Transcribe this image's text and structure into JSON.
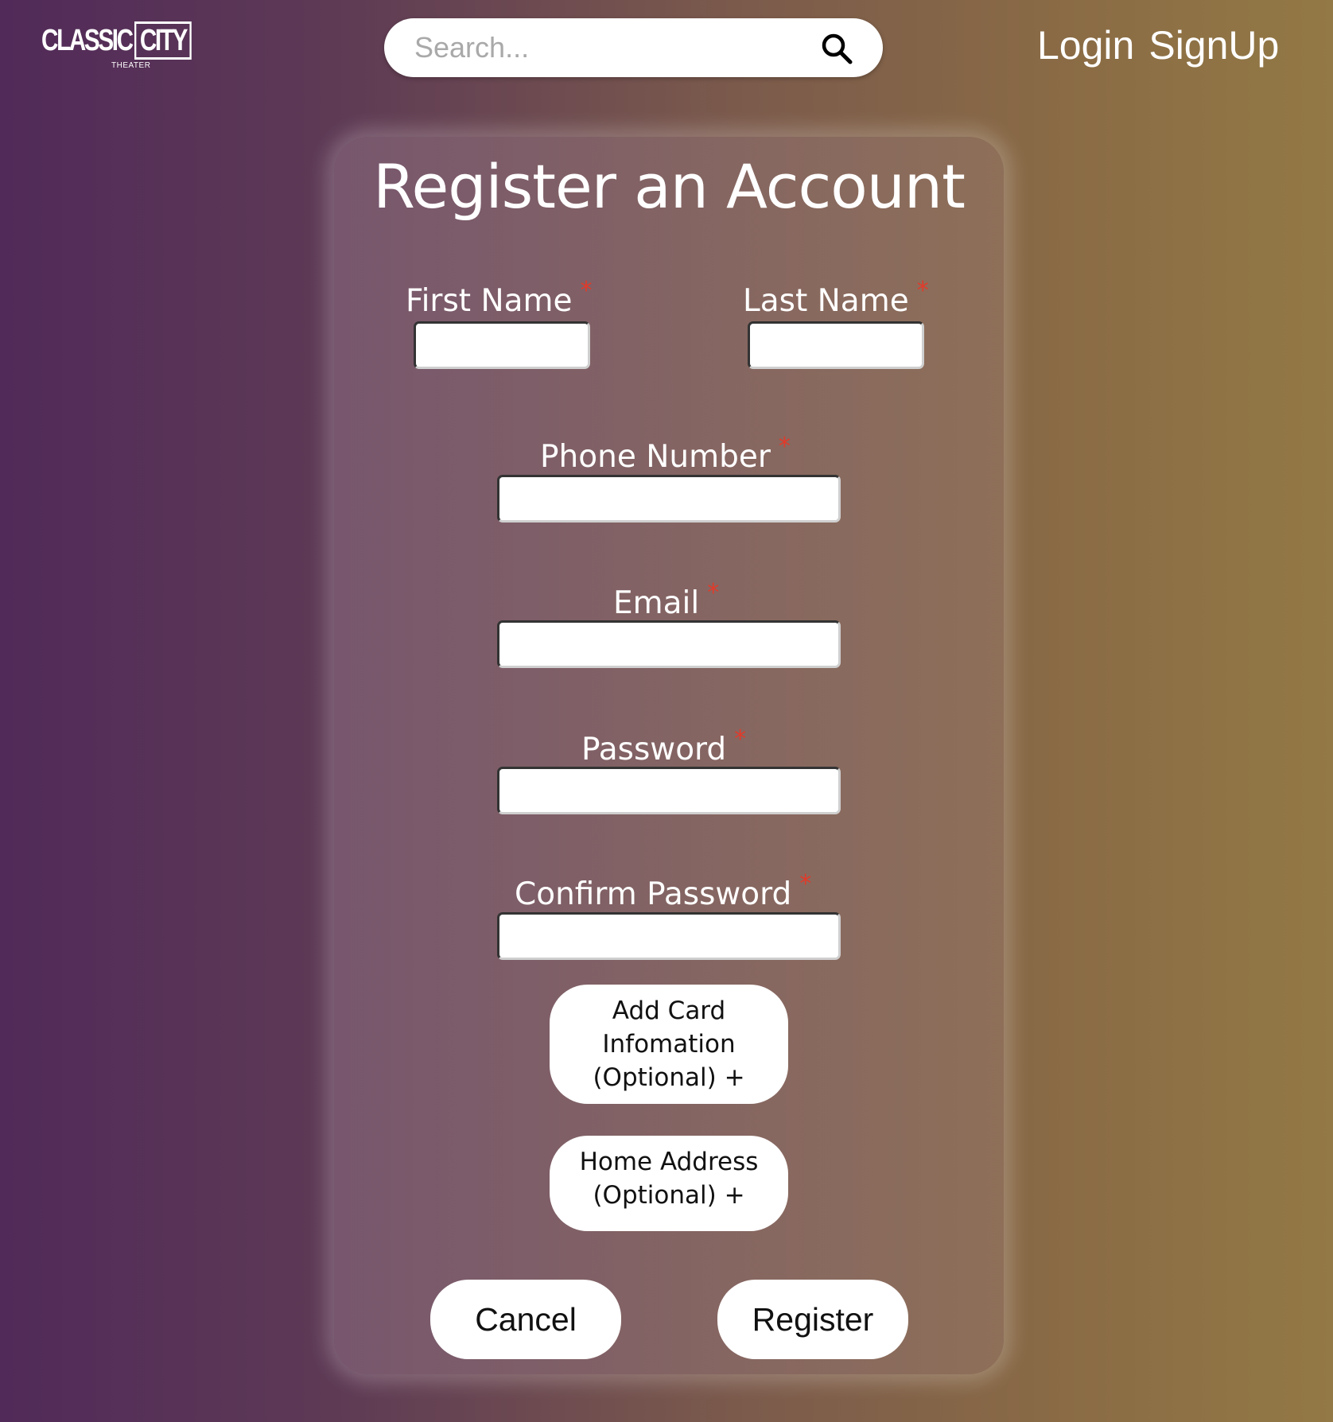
{
  "header": {
    "logo": {
      "main_left": "CLASSIC",
      "main_right": "CITY",
      "sub": "THEATER"
    },
    "search": {
      "placeholder": "Search...",
      "value": "",
      "icon": "search-icon"
    },
    "nav": {
      "login": "Login",
      "signup": "SignUp"
    }
  },
  "form": {
    "title": "Register an Account",
    "required_mark": "*",
    "fields": {
      "first_name": {
        "label": "First Name",
        "value": ""
      },
      "last_name": {
        "label": "Last Name",
        "value": ""
      },
      "phone": {
        "label": "Phone Number",
        "value": ""
      },
      "email": {
        "label": "Email",
        "value": ""
      },
      "password": {
        "label": "Password",
        "value": ""
      },
      "confirm_password": {
        "label": "Confirm Password",
        "value": ""
      }
    },
    "optional_buttons": {
      "card_line1": "Add Card",
      "card_line2": "Infomation",
      "card_line3": "(Optional) +",
      "address_line1": "Home Address",
      "address_line2": "(Optional) +"
    },
    "actions": {
      "cancel": "Cancel",
      "register": "Register"
    }
  },
  "colors": {
    "gradient_left": "#512a59",
    "gradient_right": "#937945",
    "required": "#e23a2a",
    "button_bg": "#ffffff"
  }
}
